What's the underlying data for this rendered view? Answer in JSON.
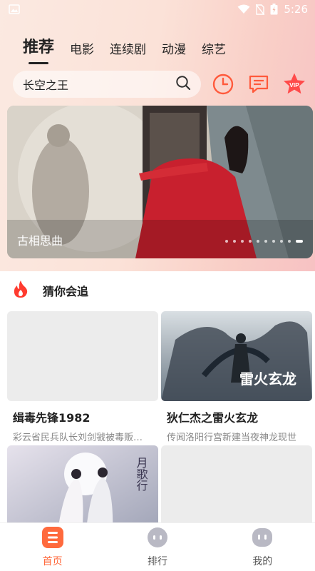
{
  "status_bar": {
    "time": "5:26"
  },
  "tabs": [
    {
      "label": "推荐",
      "active": true
    },
    {
      "label": "电影"
    },
    {
      "label": "连续剧"
    },
    {
      "label": "动漫"
    },
    {
      "label": "综艺"
    }
  ],
  "search": {
    "text": "长空之王"
  },
  "action_icons": [
    "history-icon",
    "message-icon",
    "vip-icon"
  ],
  "vip_label": "VIP",
  "banner": {
    "title": "古相思曲",
    "slide_count": 10,
    "active_slide": 9
  },
  "section": {
    "title": "猜你会追"
  },
  "cards": [
    {
      "title": "缉毒先锋1982",
      "desc": "彩云省民兵队长刘剑虢被毒贩打伤"
    },
    {
      "title": "狄仁杰之雷火玄龙",
      "desc": "传闻洛阳行宫新建当夜神龙现世"
    },
    {
      "title": "",
      "desc": ""
    },
    {
      "title": "",
      "desc": ""
    }
  ],
  "poster_text": {
    "card2": "雷火玄龙",
    "card3": "月歌行"
  },
  "bottom_nav": [
    {
      "label": "首页",
      "active": true
    },
    {
      "label": "排行"
    },
    {
      "label": "我的"
    }
  ],
  "colors": {
    "accent": "#ff6a3d",
    "vip": "#ff4b4b"
  }
}
